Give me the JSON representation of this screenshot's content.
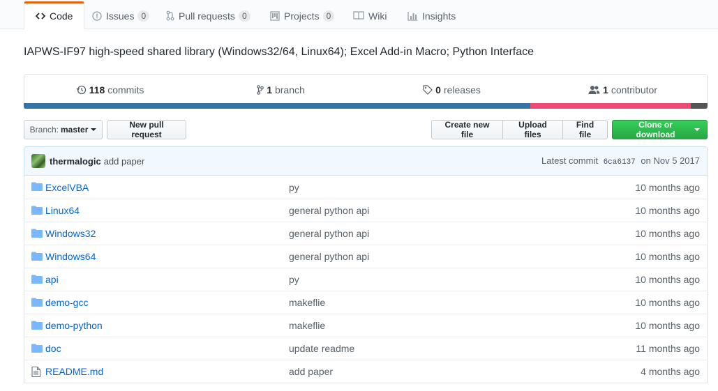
{
  "tabs": [
    {
      "label": "Code"
    },
    {
      "label": "Issues",
      "count": "0"
    },
    {
      "label": "Pull requests",
      "count": "0"
    },
    {
      "label": "Projects",
      "count": "0"
    },
    {
      "label": "Wiki"
    },
    {
      "label": "Insights"
    }
  ],
  "description": "IAPWS-IF97 high-speed shared library (Windows32/64, Linux64); Excel Add-in Macro; Python Interface",
  "summary": {
    "commits_count": "118",
    "commits_label": "commits",
    "branch_count": "1",
    "branch_label": "branch",
    "releases_count": "0",
    "releases_label": "releases",
    "contributors_count": "1",
    "contributors_label": "contributor"
  },
  "languages": {
    "colors": [
      "#3572A5",
      "#ea4a73",
      "#555555"
    ],
    "fractions": [
      0.741,
      0.235,
      0.024
    ]
  },
  "toolbar": {
    "branch_prefix": "Branch:",
    "branch_name": "master",
    "new_pr": "New pull request",
    "create_file": "Create new file",
    "upload_files": "Upload files",
    "find_file": "Find file",
    "clone": "Clone or download"
  },
  "commit": {
    "author": "thermalogic",
    "message": "add paper",
    "latest_label": "Latest commit",
    "sha": "6ca6137",
    "date": "on Nov 5 2017"
  },
  "files": [
    {
      "name": "ExcelVBA",
      "type": "dir",
      "message": "py",
      "age": "10 months ago"
    },
    {
      "name": "Linux64",
      "type": "dir",
      "message": "general python api",
      "age": "10 months ago"
    },
    {
      "name": "Windows32",
      "type": "dir",
      "message": "general python api",
      "age": "10 months ago"
    },
    {
      "name": "Windows64",
      "type": "dir",
      "message": "general python api",
      "age": "10 months ago"
    },
    {
      "name": "api",
      "type": "dir",
      "message": "py",
      "age": "10 months ago"
    },
    {
      "name": "demo-gcc",
      "type": "dir",
      "message": "makeflie",
      "age": "10 months ago"
    },
    {
      "name": "demo-python",
      "type": "dir",
      "message": "makeflie",
      "age": "10 months ago"
    },
    {
      "name": "doc",
      "type": "dir",
      "message": "update readme",
      "age": "11 months ago"
    },
    {
      "name": "README.md",
      "type": "file",
      "message": "add paper",
      "age": "4 months ago"
    }
  ],
  "colors": {
    "accent": "#e36209",
    "link": "#0366d6",
    "green": "#28a745"
  }
}
